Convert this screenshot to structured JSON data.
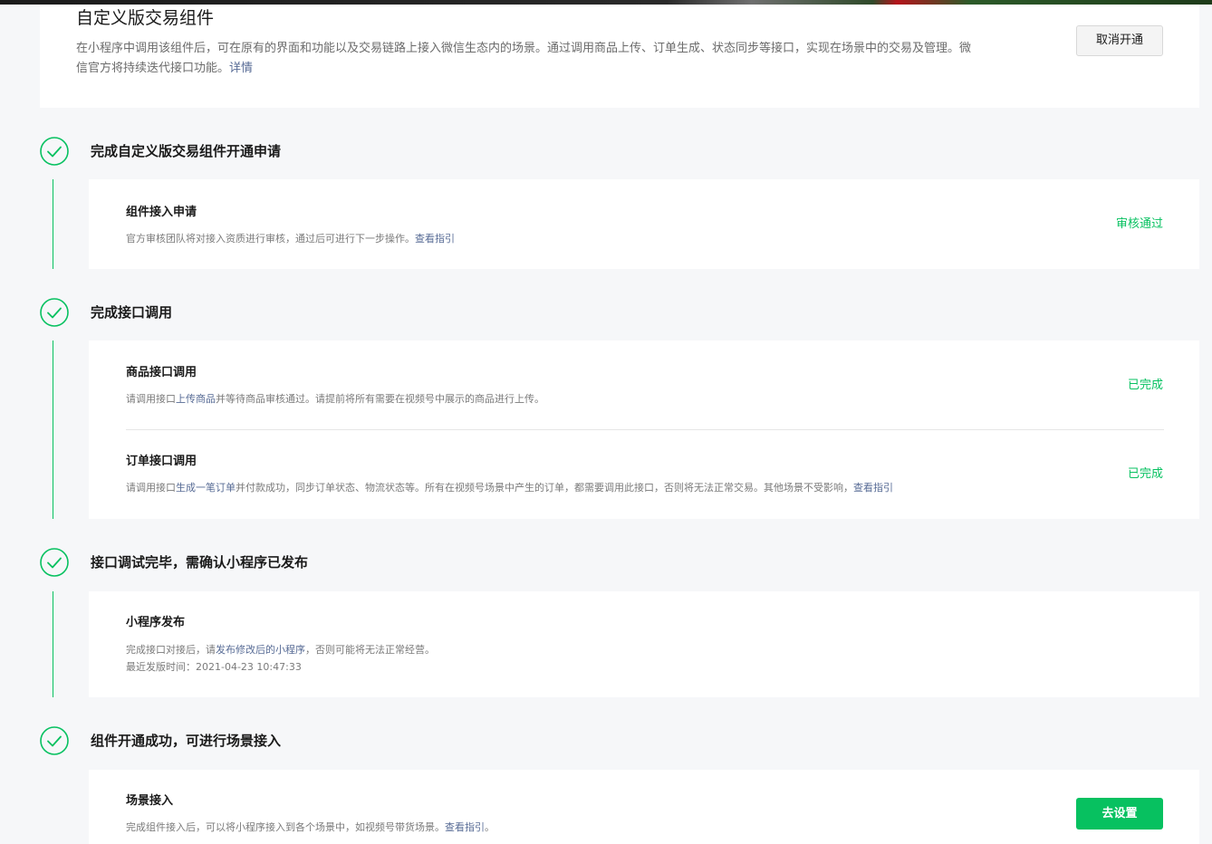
{
  "intro": {
    "title": "自定义版交易组件",
    "desc_part1": "在小程序中调用该组件后，可在原有的界面和功能以及交易链路上接入微信生态内的场景。通过调用商品上传、订单生成、状态同步等接口，实现在场景中的交易及管理。微信官方将持续迭代接口功能。",
    "desc_link": "详情",
    "cancel_label": "取消开通"
  },
  "steps": [
    {
      "title": "完成自定义版交易组件开通申请",
      "items": [
        {
          "title": "组件接入申请",
          "desc_pre": "官方审核团队将对接入资质进行审核，通过后可进行下一步操作。",
          "desc_link": "查看指引",
          "status": "审核通过"
        }
      ]
    },
    {
      "title": "完成接口调用",
      "items": [
        {
          "title": "商品接口调用",
          "desc_pre": "请调用接口",
          "desc_link": "上传商品",
          "desc_post": "并等待商品审核通过。请提前将所有需要在视频号中展示的商品进行上传。",
          "status": "已完成"
        },
        {
          "title": "订单接口调用",
          "desc_pre": "请调用接口",
          "desc_link": "生成一笔订单",
          "desc_post": "并付款成功，同步订单状态、物流状态等。所有在视频号场景中产生的订单，都需要调用此接口，否则将无法正常交易。其他场景不受影响，",
          "desc_link2": "查看指引",
          "status": "已完成"
        }
      ]
    },
    {
      "title": "接口调试完毕，需确认小程序已发布",
      "items": [
        {
          "title": "小程序发布",
          "desc_pre": "完成接口对接后，请",
          "desc_link": "发布修改后的小程序",
          "desc_post": "，否则可能将无法正常经营。",
          "desc_line2": "最近发版时间：2021-04-23 10:47:33"
        }
      ]
    },
    {
      "title": "组件开通成功，可进行场景接入",
      "items": [
        {
          "title": "场景接入",
          "desc_pre": "完成组件接入后，可以将小程序接入到各个场景中，如视频号带货场景。",
          "desc_link": "查看指引",
          "desc_post": "。",
          "button": "去设置"
        }
      ]
    }
  ],
  "colors": {
    "accent_green": "#07c160",
    "link_blue": "#576b95",
    "background": "#f6f7f9"
  },
  "icons": {
    "step_check": "check-circle-icon"
  }
}
